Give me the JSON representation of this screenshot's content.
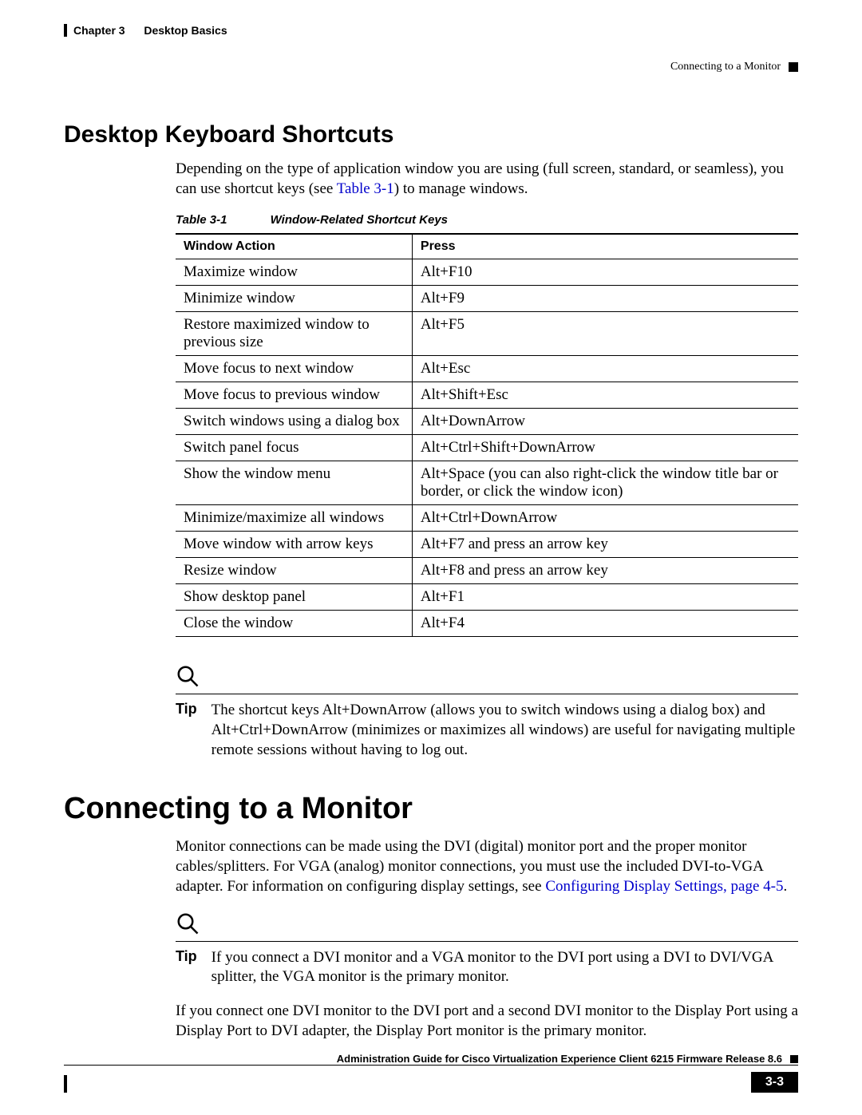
{
  "header": {
    "chapter": "Chapter 3",
    "chapter_title": "Desktop Basics",
    "section_ref": "Connecting to a Monitor"
  },
  "section1": {
    "heading": "Desktop Keyboard Shortcuts",
    "intro_a": "Depending on the type of application window you are using (full screen, standard, or seamless), you can use shortcut keys (see ",
    "intro_link": "Table 3-1",
    "intro_b": ") to manage windows."
  },
  "table": {
    "number": "Table 3-1",
    "title": "Window-Related Shortcut Keys",
    "col1": "Window Action",
    "col2": "Press",
    "rows": [
      {
        "a": "Maximize window",
        "b": "Alt+F10"
      },
      {
        "a": "Minimize window",
        "b": "Alt+F9"
      },
      {
        "a": "Restore maximized window to previous size",
        "b": "Alt+F5"
      },
      {
        "a": "Move focus to next window",
        "b": "Alt+Esc"
      },
      {
        "a": "Move focus to previous window",
        "b": "Alt+Shift+Esc"
      },
      {
        "a": "Switch windows using a dialog box",
        "b": "Alt+DownArrow"
      },
      {
        "a": "Switch panel focus",
        "b": "Alt+Ctrl+Shift+DownArrow"
      },
      {
        "a": "Show the window menu",
        "b": "Alt+Space (you can also right-click the window title bar or border, or click the window icon)"
      },
      {
        "a": "Minimize/maximize all windows",
        "b": "Alt+Ctrl+DownArrow"
      },
      {
        "a": "Move window with arrow keys",
        "b": "Alt+F7 and press an arrow key"
      },
      {
        "a": "Resize window",
        "b": "Alt+F8 and press an arrow key"
      },
      {
        "a": "Show desktop panel",
        "b": "Alt+F1"
      },
      {
        "a": "Close the window",
        "b": "Alt+F4"
      }
    ]
  },
  "tip1": {
    "label": "Tip",
    "text": "The shortcut keys Alt+DownArrow (allows you to switch windows using a dialog box) and Alt+Ctrl+DownArrow (minimizes or maximizes all windows) are useful for navigating multiple remote sessions without having to log out."
  },
  "section2": {
    "heading": "Connecting to a Monitor",
    "intro_a": "Monitor connections can be made using the DVI (digital) monitor port and the proper monitor cables/splitters. For VGA (analog) monitor connections, you must use the included DVI-to-VGA adapter. For information on configuring display settings, see ",
    "intro_link": "Configuring Display Settings, page 4-5",
    "intro_b": "."
  },
  "tip2": {
    "label": "Tip",
    "text": "If you connect a DVI monitor and a VGA monitor to the DVI port using a DVI to DVI/VGA splitter, the VGA monitor is the primary monitor."
  },
  "para_after_tip2": "If you connect one DVI monitor to the DVI port and a second DVI monitor to the Display Port using a Display Port to DVI adapter, the Display Port monitor is the primary monitor.",
  "footer": {
    "title": "Administration Guide for Cisco Virtualization Experience Client 6215 Firmware Release 8.6",
    "page": "3-3"
  }
}
